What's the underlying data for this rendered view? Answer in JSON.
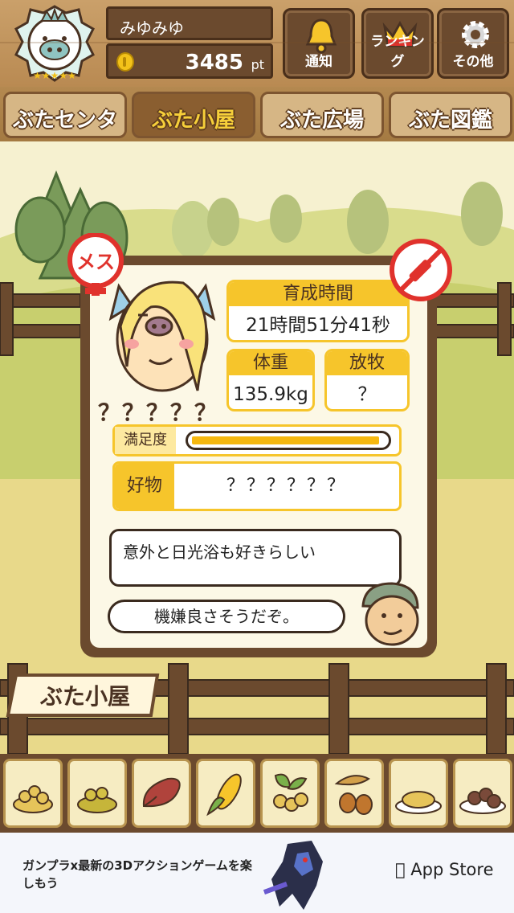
{
  "header": {
    "username": "みゆみゆ",
    "points": "3485",
    "points_unit": "pt",
    "buttons": [
      {
        "label": "通知",
        "icon": "bell-icon"
      },
      {
        "label": "ランキング",
        "icon": "crown-icon"
      },
      {
        "label": "その他",
        "icon": "gear-icon"
      }
    ]
  },
  "tabs": [
    {
      "label": "ぶたセンター",
      "active": false
    },
    {
      "label": "ぶた小屋",
      "active": true
    },
    {
      "label": "ぶた広場",
      "active": false
    },
    {
      "label": "ぶた図鑑",
      "active": false
    }
  ],
  "pig": {
    "name": "？？？？？",
    "gender_badge": "メス",
    "growth_time_label": "育成時間",
    "growth_time_value": "21時間51分41秒",
    "weight_label": "体重",
    "weight_value": "135.9kg",
    "grazing_label": "放牧",
    "grazing_value": "？",
    "satisfaction_label": "満足度",
    "satisfaction_level": 0.97,
    "favorite_label": "好物",
    "favorite_value": "？？？？？？"
  },
  "messages": {
    "hint": "意外と日光浴も好きらしい",
    "farmer": "機嫌良さそうだぞ。"
  },
  "sign": {
    "label": "ぶた小屋"
  },
  "foods": [
    "soybeans",
    "mixed-grain",
    "sweet-potato",
    "corn",
    "vegetables",
    "acorns",
    "grain-plate",
    "meatball-plate"
  ],
  "ad": {
    "text": "ガンプラx最新の3Dアクションゲームを楽しもう",
    "store": "App Store"
  },
  "colors": {
    "accent": "#f6c52b",
    "wood": "#6b4a2e",
    "female": "#e0322c"
  }
}
